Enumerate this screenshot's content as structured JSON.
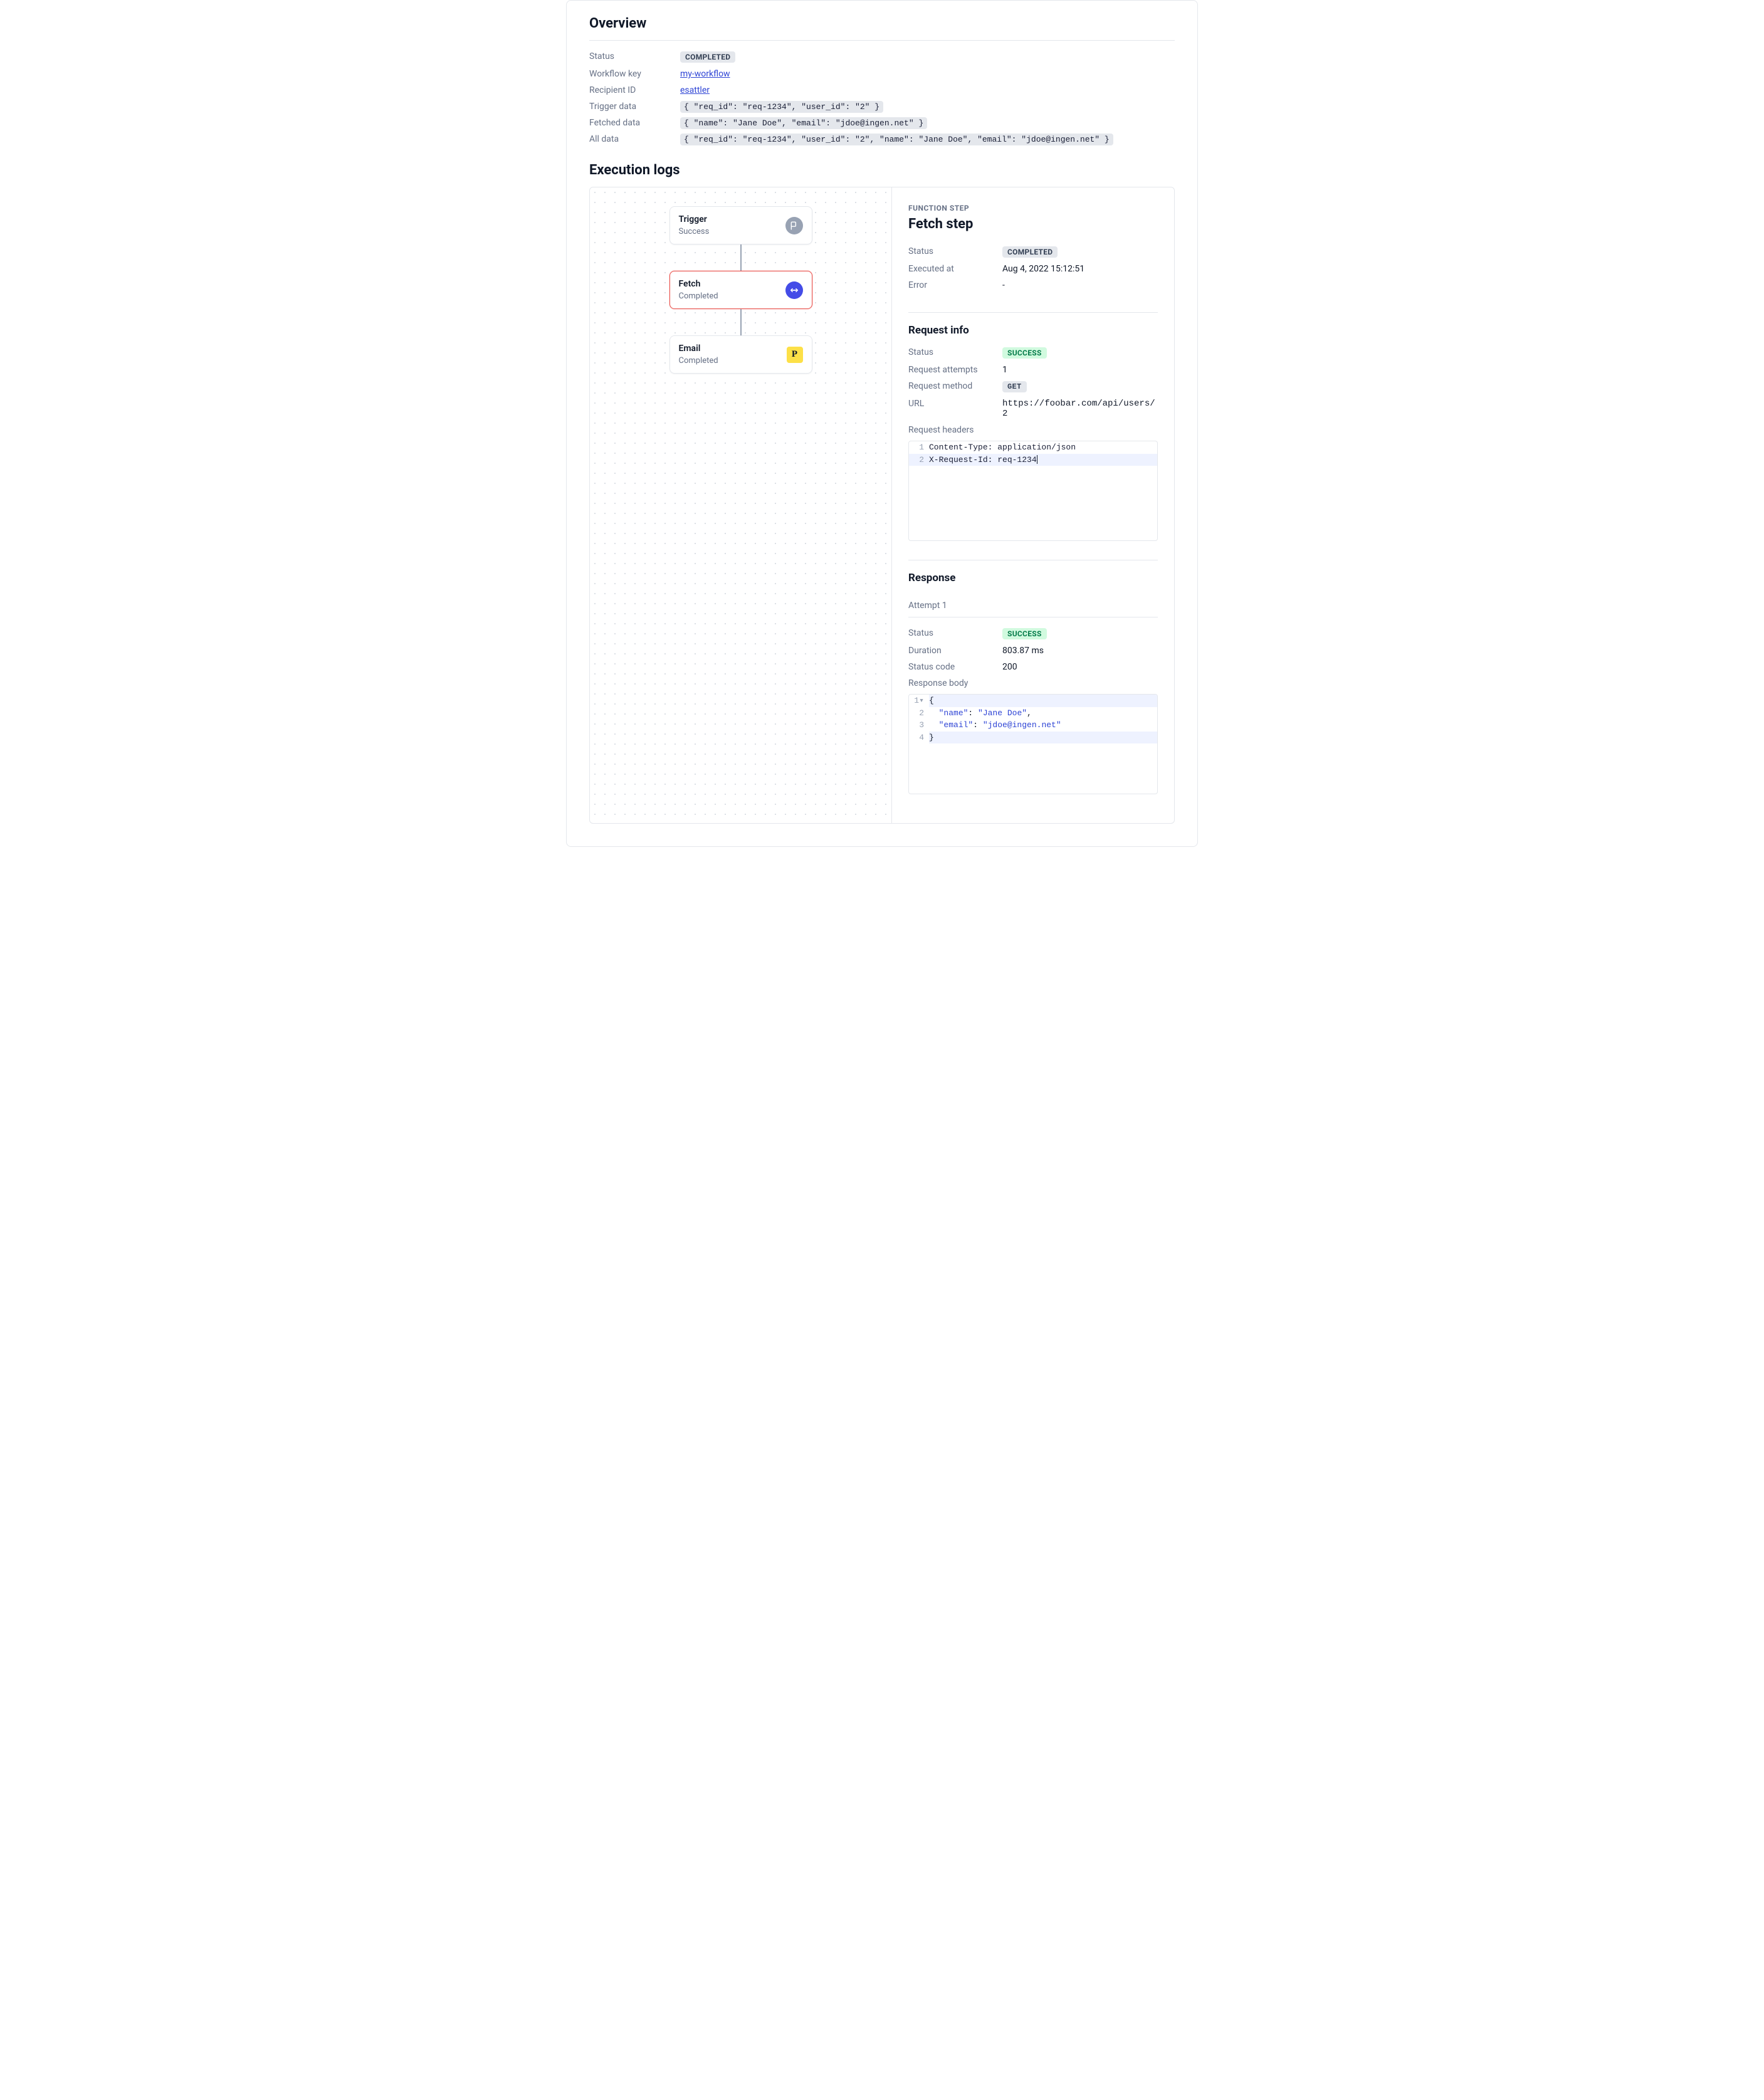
{
  "overview": {
    "title": "Overview",
    "rows": {
      "status_label": "Status",
      "status_value": "COMPLETED",
      "workflow_key_label": "Workflow key",
      "workflow_key_value": "my-workflow",
      "recipient_id_label": "Recipient ID",
      "recipient_id_value": "esattler",
      "trigger_data_label": "Trigger data",
      "trigger_data_value": "{ \"req_id\": \"req-1234\", \"user_id\": \"2\" }",
      "fetched_data_label": "Fetched data",
      "fetched_data_value": "{ \"name\": \"Jane Doe\", \"email\": \"jdoe@ingen.net\" }",
      "all_data_label": "All data",
      "all_data_value": "{ \"req_id\": \"req-1234\", \"user_id\": \"2\", \"name\": \"Jane Doe\", \"email\": \"jdoe@ingen.net\" }"
    }
  },
  "execution_logs": {
    "title": "Execution logs",
    "nodes": {
      "trigger": {
        "title": "Trigger",
        "sub": "Success"
      },
      "fetch": {
        "title": "Fetch",
        "sub": "Completed"
      },
      "email": {
        "title": "Email",
        "sub": "Completed"
      }
    }
  },
  "detail": {
    "eyebrow": "FUNCTION STEP",
    "title": "Fetch step",
    "summary": {
      "status_label": "Status",
      "status_value": "COMPLETED",
      "executed_at_label": "Executed at",
      "executed_at_value": "Aug 4, 2022 15:12:51",
      "error_label": "Error",
      "error_value": "-"
    },
    "request_info": {
      "title": "Request info",
      "status_label": "Status",
      "status_value": "SUCCESS",
      "attempts_label": "Request attempts",
      "attempts_value": "1",
      "method_label": "Request method",
      "method_value": "GET",
      "url_label": "URL",
      "url_value": "https://foobar.com/api/users/2",
      "headers_label": "Request headers",
      "headers_lines": {
        "l1": "Content-Type: application/json",
        "l2": "X-Request-Id: req-1234"
      }
    },
    "response": {
      "title": "Response",
      "attempt_label": "Attempt 1",
      "status_label": "Status",
      "status_value": "SUCCESS",
      "duration_label": "Duration",
      "duration_value": "803.87 ms",
      "status_code_label": "Status code",
      "status_code_value": "200",
      "body_label": "Response body",
      "body": {
        "open": "{",
        "name_k": "\"name\"",
        "name_v": "\"Jane Doe\"",
        "email_k": "\"email\"",
        "email_v": "\"jdoe@ingen.net\"",
        "close": "}"
      }
    }
  },
  "gutter": {
    "n1": "1",
    "n2": "2",
    "n3": "3",
    "n4": "4"
  },
  "icon_glyph": {
    "p": "P"
  }
}
